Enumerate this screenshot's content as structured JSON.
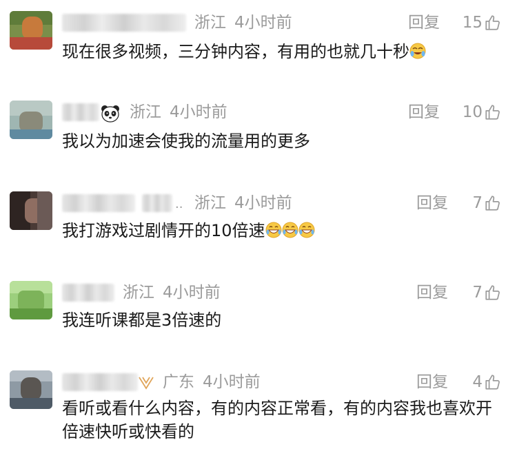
{
  "comments": [
    {
      "location": "浙江",
      "time": "4小时前",
      "reply_label": "回复",
      "likes": "15",
      "text": "现在很多视频，三分钟内容，有用的也就几十秒",
      "emoji": [
        "sweat-laugh-emoji"
      ]
    },
    {
      "location": "浙江",
      "time": "4小时前",
      "reply_label": "回复",
      "likes": "10",
      "text": "我以为加速会使我的流量用的更多",
      "name_badge": "panda-icon"
    },
    {
      "name_extra": "..",
      "location": "浙江",
      "time": "4小时前",
      "reply_label": "回复",
      "likes": "7",
      "text": "我打游戏过剧情开的10倍速",
      "emoji": [
        "grin-sweat-emoji",
        "grin-sweat-emoji",
        "grin-sweat-emoji"
      ]
    },
    {
      "location": "浙江",
      "time": "4小时前",
      "reply_label": "回复",
      "likes": "7",
      "text": "我连听课都是3倍速的"
    },
    {
      "location": "广东",
      "time": "4小时前",
      "reply_label": "回复",
      "likes": "4",
      "text": "看听或看什么内容，有的内容正常看，有的内容我也喜欢开倍速快听或快看的",
      "name_badge": "gold-badge-icon"
    }
  ],
  "colors": {
    "meta_gray": "#9b9b9b",
    "text": "#1a1a1a",
    "badge_gold": "#e0a55a"
  }
}
